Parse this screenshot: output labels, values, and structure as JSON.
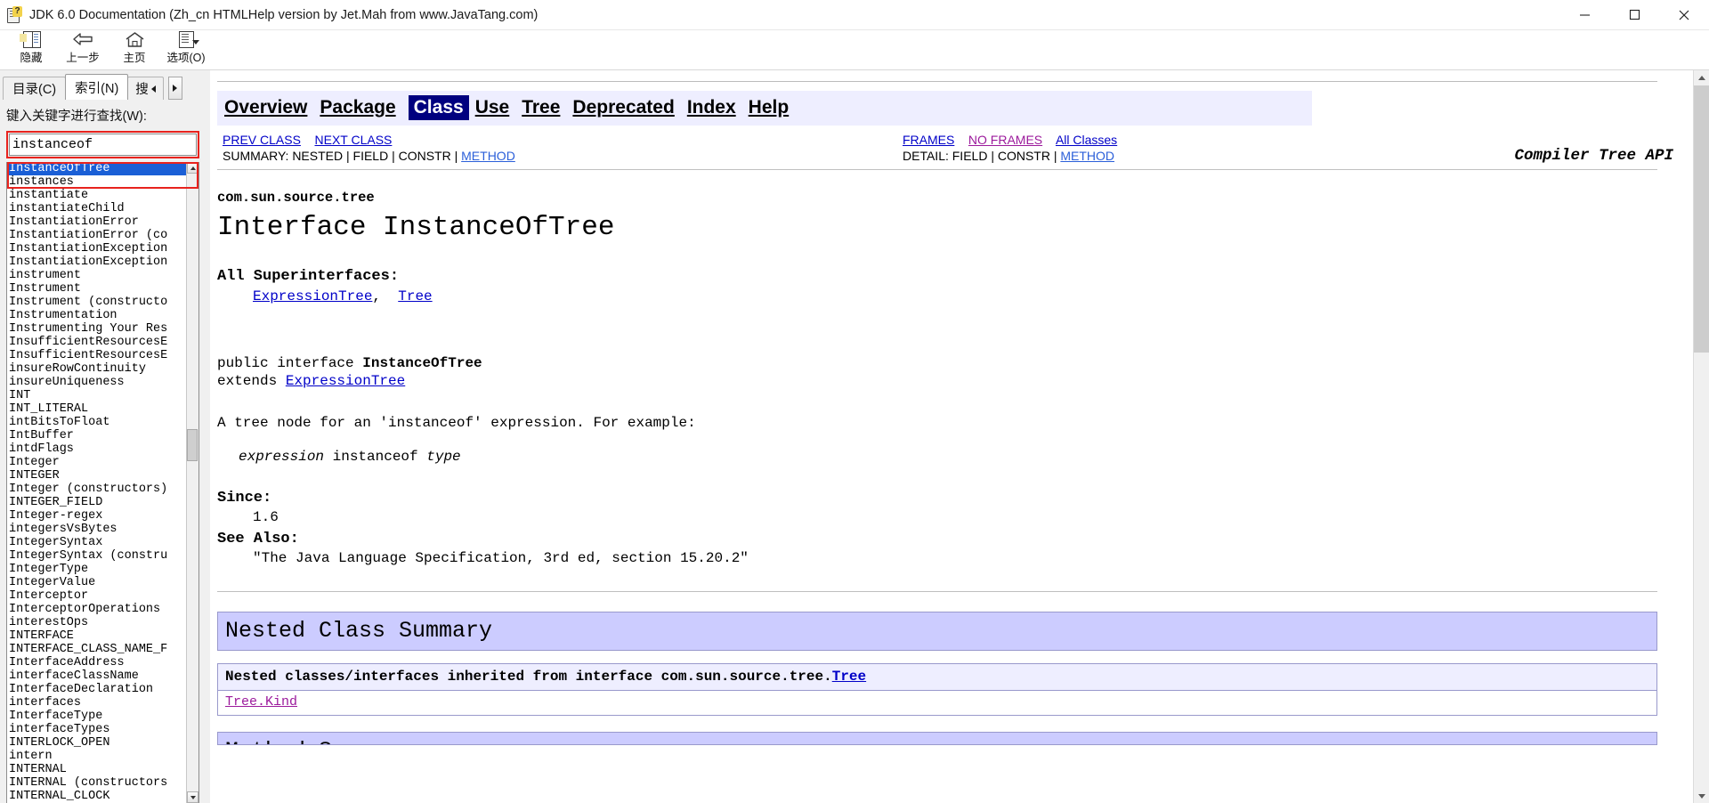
{
  "window": {
    "title": "JDK 6.0 Documentation (Zh_cn HTMLHelp version by Jet.Mah from www.JavaTang.com)",
    "icon": "help-document-icon",
    "minimize_label": "Minimize",
    "maximize_label": "Maximize",
    "close_label": "Close"
  },
  "toolbar": {
    "buttons": [
      {
        "label": "隐藏",
        "icon": "hide-panel-icon"
      },
      {
        "label": "上一步",
        "icon": "back-arrow-icon"
      },
      {
        "label": "主页",
        "icon": "home-icon"
      },
      {
        "label": "选项(O)",
        "icon": "options-icon"
      }
    ]
  },
  "sidebar": {
    "tabs": [
      {
        "label": "目录(C)",
        "underline": "C",
        "active": false
      },
      {
        "label": "索引(N)",
        "underline": "N",
        "active": true
      },
      {
        "label": "搜",
        "active": false,
        "partial": true
      }
    ],
    "keyword_label": "键入关键字进行查找(W):",
    "search_value": "instanceof",
    "search_placeholder": "",
    "index_items": [
      "InstanceOfTree",
      "instances",
      "instantiate",
      "instantiateChild",
      "InstantiationError",
      "InstantiationError (co",
      "InstantiationException",
      "InstantiationException",
      "instrument",
      "Instrument",
      "Instrument (constructo",
      "Instrumentation",
      "Instrumenting Your Res",
      "InsufficientResourcesE",
      "InsufficientResourcesE",
      "insureRowContinuity",
      "insureUniqueness",
      "INT",
      "INT_LITERAL",
      "intBitsToFloat",
      "IntBuffer",
      "intdFlags",
      "Integer",
      "INTEGER",
      "Integer (constructors)",
      "INTEGER_FIELD",
      "Integer-regex",
      "integersVsBytes",
      "IntegerSyntax",
      "IntegerSyntax (constru",
      "IntegerType",
      "IntegerValue",
      "Interceptor",
      "InterceptorOperations",
      "interestOps",
      "INTERFACE",
      "INTERFACE_CLASS_NAME_F",
      "InterfaceAddress",
      "interfaceClassName",
      "InterfaceDeclaration",
      "interfaces",
      "InterfaceType",
      "interfaceTypes",
      "INTERLOCK_OPEN",
      "intern",
      "INTERNAL",
      "INTERNAL (constructors",
      "INTERNAL_CLOCK"
    ],
    "selected_index": 0
  },
  "document": {
    "nav": {
      "items": [
        {
          "label": "Overview",
          "current": false
        },
        {
          "label": "Package",
          "current": false
        },
        {
          "label": "Class",
          "current": true
        },
        {
          "label": "Use",
          "current": false
        },
        {
          "label": "Tree",
          "current": false
        },
        {
          "label": "Deprecated",
          "current": false
        },
        {
          "label": "Index",
          "current": false
        },
        {
          "label": "Help",
          "current": false
        }
      ],
      "api_title": "Compiler Tree API"
    },
    "subnav": {
      "prev_class": "PREV CLASS",
      "next_class": "NEXT CLASS",
      "summary_prefix": "SUMMARY: NESTED | FIELD | CONSTR | ",
      "summary_method": "METHOD",
      "frames": "FRAMES",
      "no_frames": "NO FRAMES",
      "all_classes": "All Classes",
      "detail_prefix": "DETAIL: FIELD | CONSTR | ",
      "detail_method": "METHOD"
    },
    "package_name": "com.sun.source.tree",
    "class_title": "Interface InstanceOfTree",
    "superinterfaces_heading": "All Superinterfaces:",
    "superinterfaces": [
      "ExpressionTree",
      "Tree"
    ],
    "declaration_line1_prefix": "public interface ",
    "declaration_line1_name": "InstanceOfTree",
    "declaration_line2_prefix": "extends ",
    "declaration_line2_link": "ExpressionTree",
    "description": "A tree node for an 'instanceof' expression. For example:",
    "example_expression": "expression",
    "example_keyword": " instanceof ",
    "example_type": "type",
    "since_heading": "Since:",
    "since_value": "1.6",
    "seealso_heading": "See Also:",
    "seealso_value": "\"The Java Language Specification, 3rd ed, section 15.20.2\"",
    "nested_summary_title": "Nested Class Summary",
    "inherited_prefix": "Nested classes/interfaces inherited from interface com.sun.source.tree.",
    "inherited_link": "Tree",
    "inherited_item": "Tree.Kind",
    "next_section_title": "Method Summary"
  },
  "colors": {
    "accent_blue": "#00007f",
    "selection_blue": "#1a5fd6",
    "link_blue": "#0000c8",
    "link_visited": "#9c1a9c",
    "band_purple": "#ccccff",
    "band_light": "#eeeeff",
    "highlight_red": "#e8231e"
  }
}
